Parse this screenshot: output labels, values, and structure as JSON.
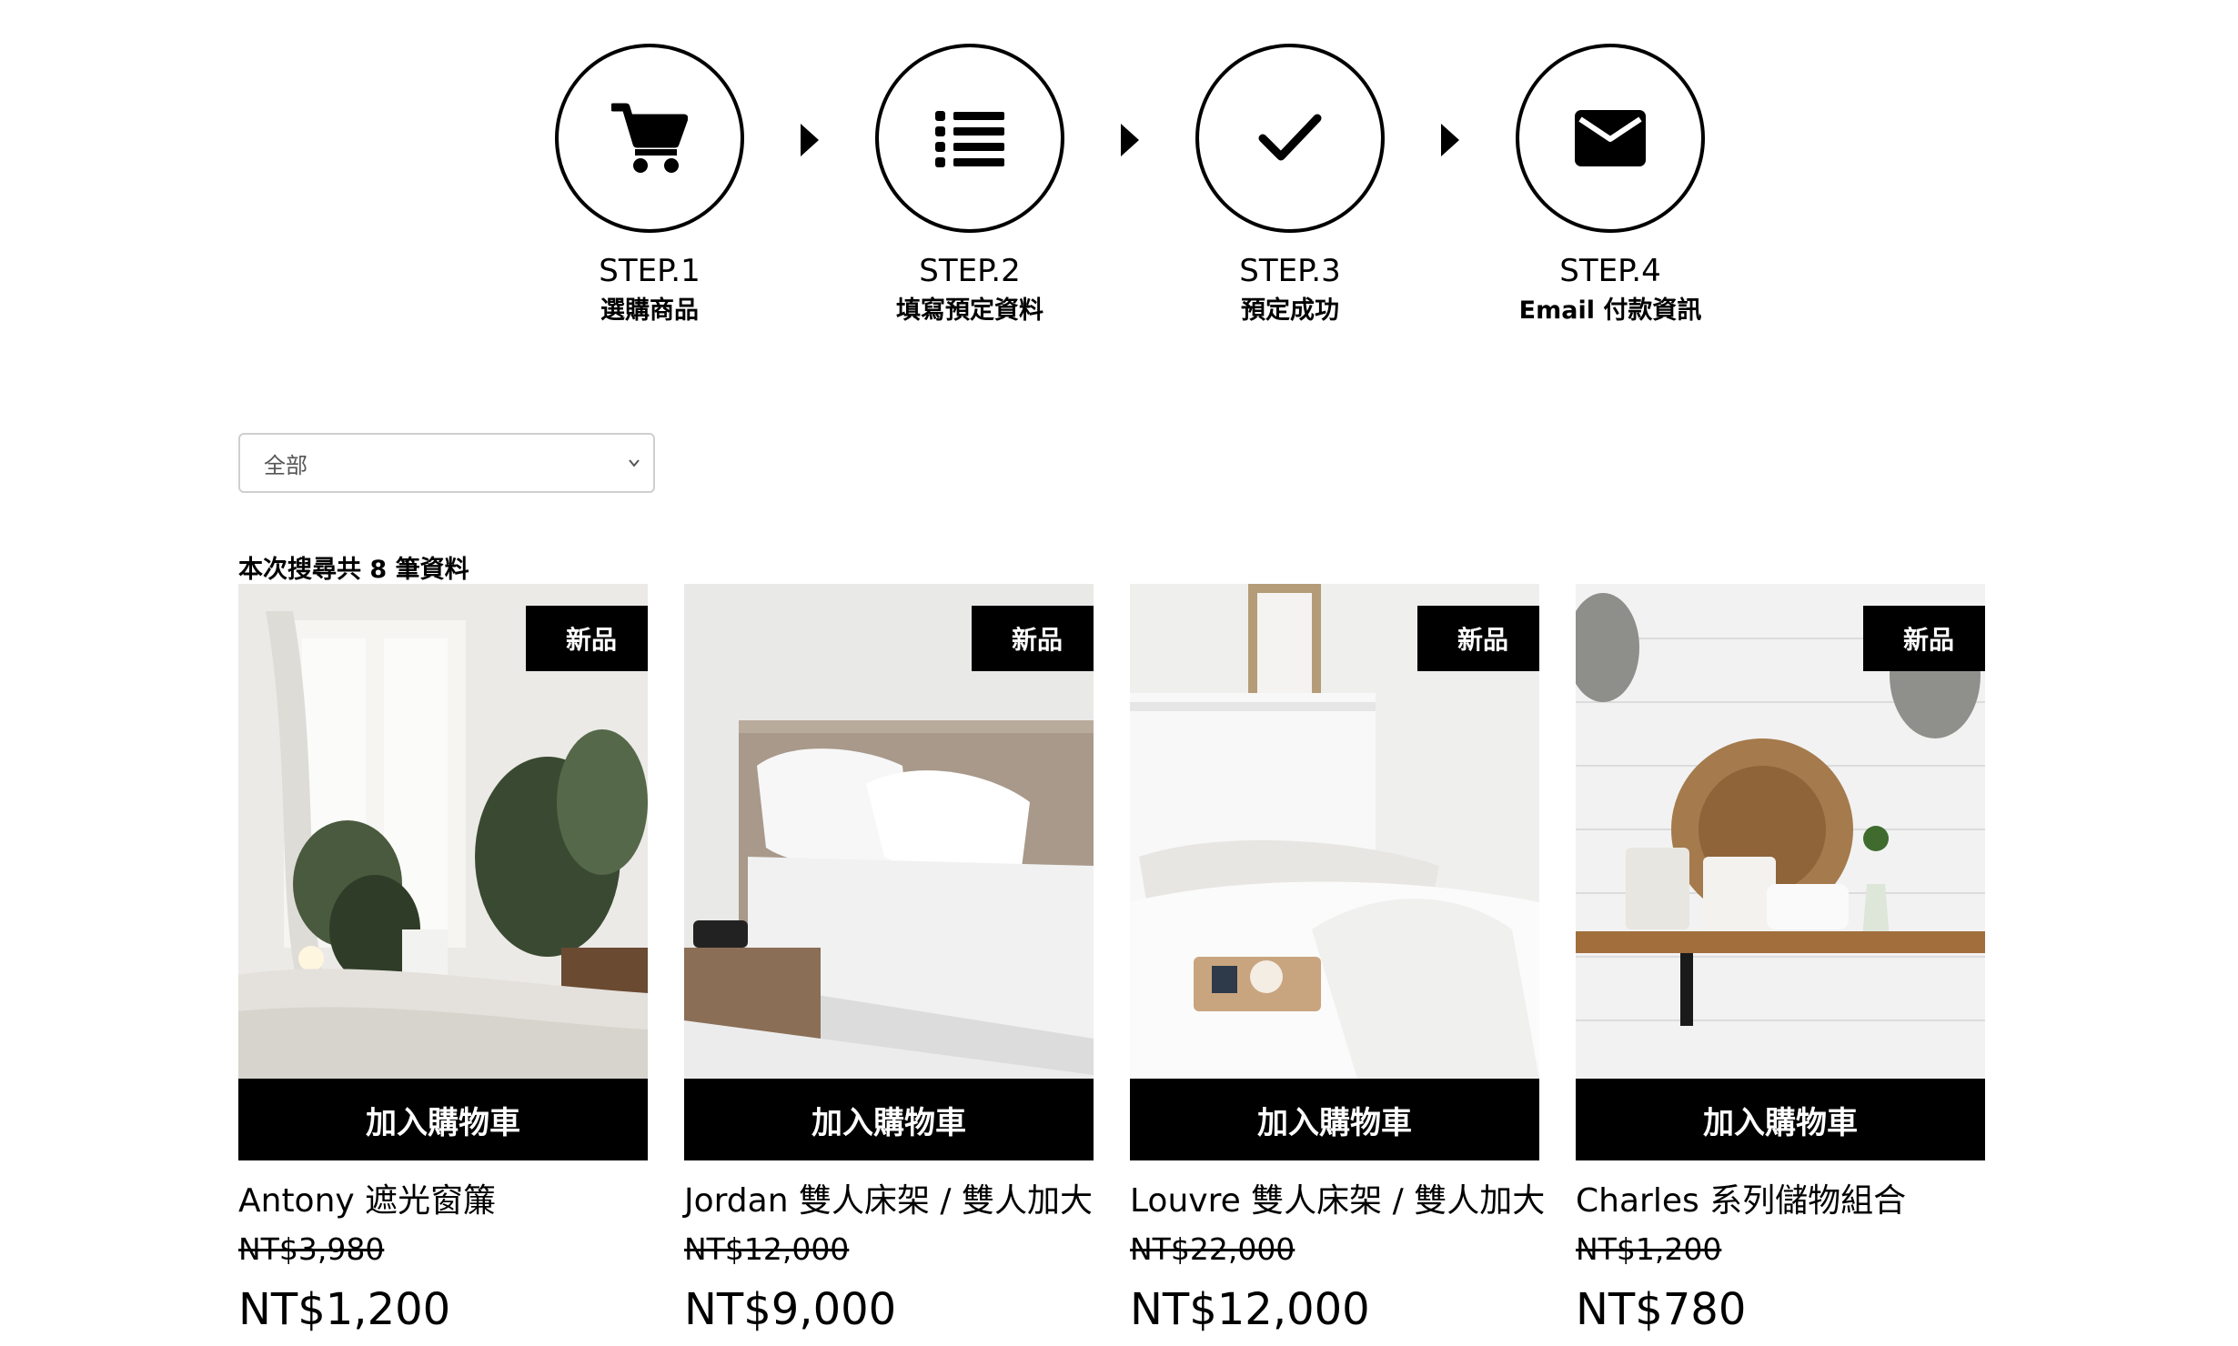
{
  "steps": [
    {
      "label": "STEP.1",
      "sub": "選購商品",
      "icon": "cart-icon"
    },
    {
      "label": "STEP.2",
      "sub": "填寫預定資料",
      "icon": "list-icon"
    },
    {
      "label": "STEP.3",
      "sub": "預定成功",
      "icon": "check-icon"
    },
    {
      "label": "STEP.4",
      "sub": "Email 付款資訊",
      "icon": "envelope-icon"
    }
  ],
  "filter": {
    "selected": "全部"
  },
  "result_count": "本次搜尋共 8 筆資料",
  "products": [
    {
      "badge": "新品",
      "cart_label": "加入購物車",
      "name": "Antony 遮光窗簾",
      "original_price": "NT$3,980",
      "price": "NT$1,200"
    },
    {
      "badge": "新品",
      "cart_label": "加入購物車",
      "name": "Jordan 雙人床架 / 雙人加大",
      "original_price": "NT$12,000",
      "price": "NT$9,000"
    },
    {
      "badge": "新品",
      "cart_label": "加入購物車",
      "name": "Louvre 雙人床架 / 雙人加大",
      "original_price": "NT$22,000",
      "price": "NT$12,000"
    },
    {
      "badge": "新品",
      "cart_label": "加入購物車",
      "name": "Charles 系列儲物組合",
      "original_price": "NT$1,200",
      "price": "NT$780"
    }
  ]
}
